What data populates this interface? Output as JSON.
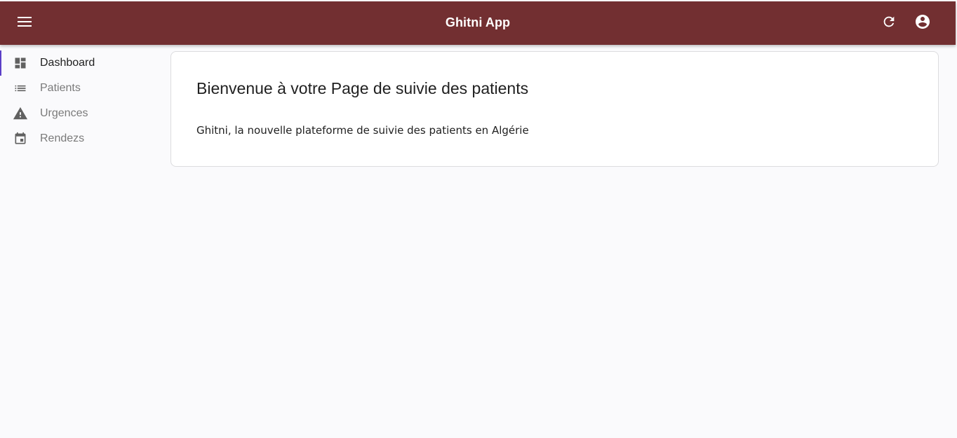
{
  "appbar": {
    "title": "Ghitni App",
    "background_color": "#722f31",
    "menu_icon": "menu-icon",
    "refresh_icon": "refresh-icon",
    "account_icon": "account-circle-icon"
  },
  "sidebar": {
    "active_indicator_color": "#5b3fc7",
    "items": [
      {
        "label": "Dashboard",
        "icon": "dashboard-icon",
        "active": true
      },
      {
        "label": "Patients",
        "icon": "list-icon",
        "active": false
      },
      {
        "label": "Urgences",
        "icon": "warning-icon",
        "active": false
      },
      {
        "label": "Rendezs",
        "icon": "calendar-icon",
        "active": false
      }
    ]
  },
  "main": {
    "card": {
      "title": "Bienvenue à votre Page de suivie des patients",
      "text": "Ghitni, la nouvelle plateforme de suivie des patients en Algérie"
    }
  }
}
